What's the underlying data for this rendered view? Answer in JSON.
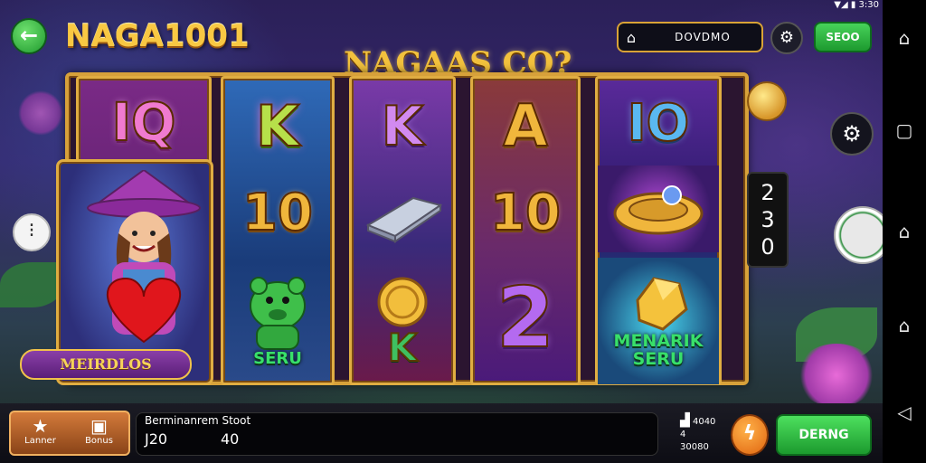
{
  "header": {
    "back_icon": "arrow-left-icon",
    "logo_text": "NAGA1001",
    "game_title": "NAGAAS CO?",
    "balance": "DOVDMO",
    "balance_icon": "home-icon",
    "settings_icon": "gear-icon",
    "green_button": "SEOO"
  },
  "reels": [
    {
      "top": "IQ",
      "middle": "",
      "bottom": "",
      "card_label": "MEIRDLOS"
    },
    {
      "top": "K",
      "middle": "10",
      "bottom_text": "SERU"
    },
    {
      "top": "K",
      "middle": "",
      "bottom": "K"
    },
    {
      "top": "A",
      "middle": "10",
      "bottom": "2"
    },
    {
      "top": "IO",
      "middle": "",
      "bottom_text": "MENARIK SERU"
    }
  ],
  "side": {
    "menu_icon": "dots-icon",
    "settings_icon": "gear-icon",
    "counter": [
      "2",
      "3",
      "0"
    ]
  },
  "bottom": {
    "fav_label": "Lanner",
    "fav_icon": "star-icon",
    "bonus_label": "Bonus",
    "bonus_icon": "box-icon",
    "info_title": "Berminanrem Stoot",
    "info_val1": "J20",
    "info_val2": "40",
    "mini_line1": "4040",
    "mini_line2": "4",
    "mini_line3": "30080",
    "orange_icon": "bolt-icon",
    "spin_button": "DERNG"
  },
  "status_bar": {
    "battery": "3:30"
  },
  "colors": {
    "gold": "#f0b63c",
    "green": "#1f9a2e",
    "orange": "#e0650f"
  }
}
